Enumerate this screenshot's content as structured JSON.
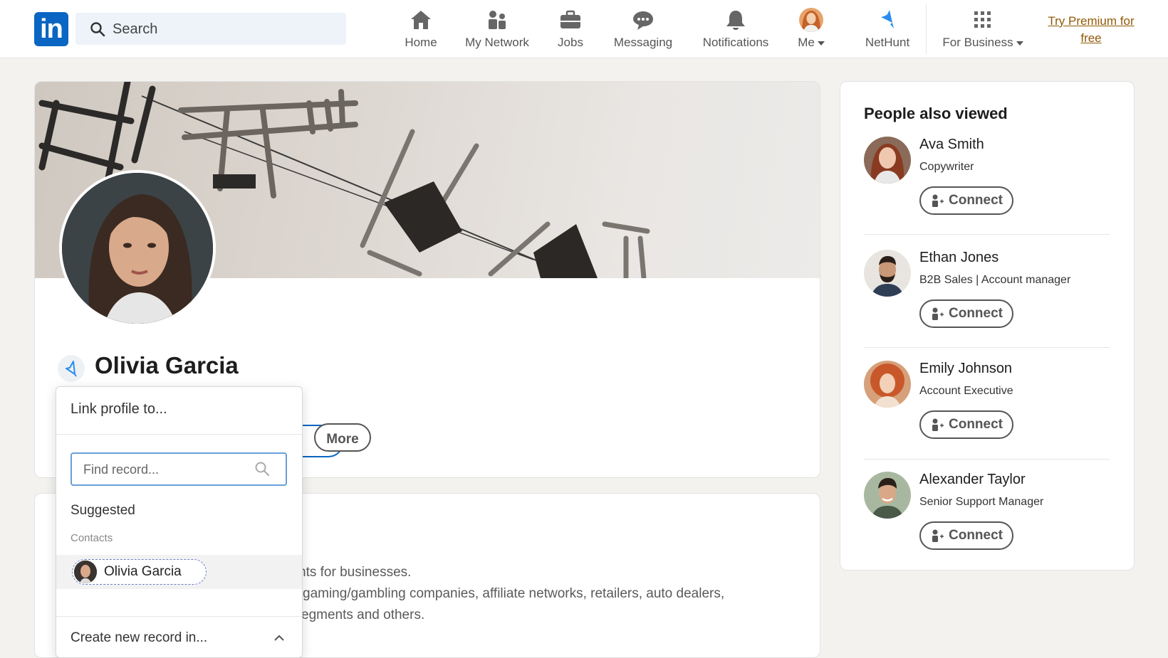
{
  "nav": {
    "logo_text": "in",
    "search_placeholder": "Search",
    "items": [
      {
        "label": "Home",
        "icon": "home-icon"
      },
      {
        "label": "My Network",
        "icon": "network-icon"
      },
      {
        "label": "Jobs",
        "icon": "briefcase-icon"
      },
      {
        "label": "Messaging",
        "icon": "messaging-icon"
      },
      {
        "label": "Notifications",
        "icon": "bell-icon"
      },
      {
        "label": "Me",
        "icon": "avatar"
      },
      {
        "label": "NetHunt",
        "icon": "nethunt-icon"
      },
      {
        "label": "For Business",
        "icon": "grid-icon"
      }
    ],
    "premium_line1": "Try Premium for",
    "premium_line2": "free"
  },
  "profile": {
    "name": "Olivia Garcia",
    "more_label": "More"
  },
  "about": {
    "lines": [
      "nts for businesses.",
      "gaming/gambling companies, affiliate networks, retailers, auto dealers,",
      "egments and others."
    ]
  },
  "dropdown": {
    "title": "Link profile to...",
    "find_placeholder": "Find record...",
    "suggested_label": "Suggested",
    "contacts_label": "Contacts",
    "contact_name": "Olivia Garcia",
    "create_label": "Create new record in..."
  },
  "sidebar": {
    "title": "People also viewed",
    "connect_label": "Connect",
    "people": [
      {
        "name": "Ava Smith",
        "role": "Copywriter"
      },
      {
        "name": "Ethan Jones",
        "role": "B2B Sales | Account manager"
      },
      {
        "name": "Emily Johnson",
        "role": "Account Executive"
      },
      {
        "name": "Alexander Taylor",
        "role": "Senior Support Manager"
      }
    ]
  },
  "colors": {
    "brand_blue": "#0a66c2",
    "premium_gold": "#915907",
    "nethunt_blue": "#2a8cf0",
    "page_bg": "#f3f2ef"
  }
}
